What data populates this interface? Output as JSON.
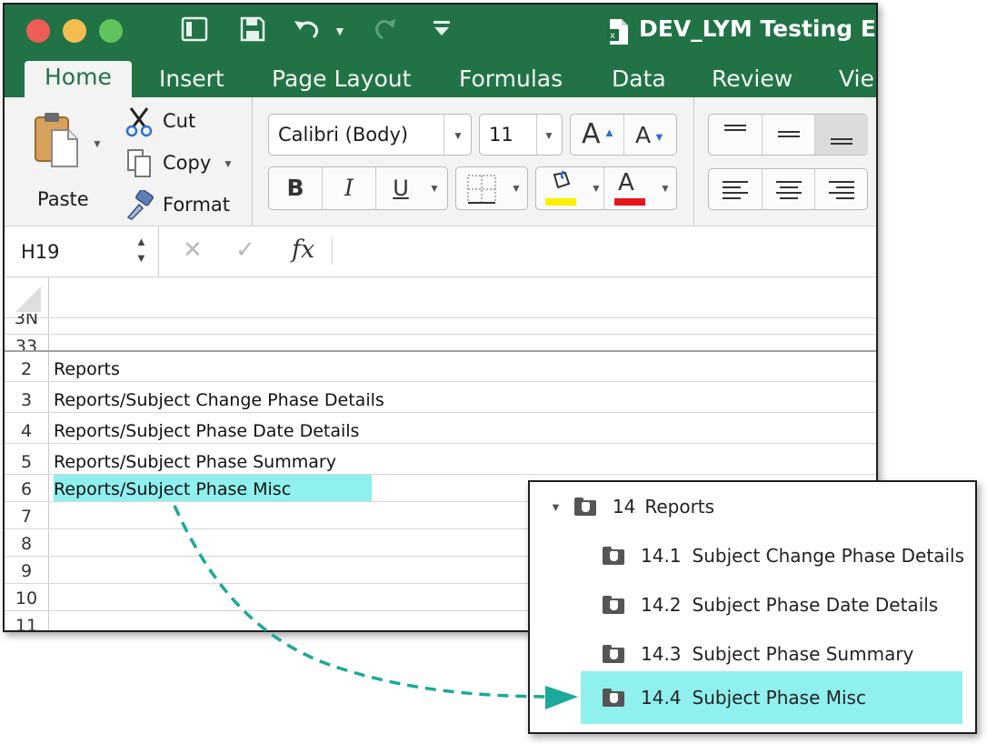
{
  "titlebar": {
    "doc_icon": "excel-file-icon",
    "doc_title": "DEV_LYM Testing Ex",
    "traffic_colors": [
      "#ee5c56",
      "#f5bd4f",
      "#5fc45c"
    ]
  },
  "tabs": [
    {
      "label": "Home",
      "active": true
    },
    {
      "label": "Insert"
    },
    {
      "label": "Page Layout"
    },
    {
      "label": "Formulas"
    },
    {
      "label": "Data"
    },
    {
      "label": "Review"
    },
    {
      "label": "Vie"
    }
  ],
  "clipboard": {
    "paste": "Paste",
    "cut": "Cut",
    "copy": "Copy",
    "format": "Format"
  },
  "font": {
    "family": "Calibri (Body)",
    "size": "11",
    "bold": "B",
    "italic": "I",
    "underline": "U",
    "grow": "A",
    "shrink": "A",
    "font_color_letter": "A",
    "highlight_color": "#ffee00",
    "font_color": "#e8141b"
  },
  "formula_bar": {
    "name_box": "H19",
    "cancel": "✕",
    "enter": "✓",
    "fx": "fx"
  },
  "sheet": {
    "partial_rows": [
      "3N",
      "33"
    ],
    "rows": [
      {
        "num": "2",
        "text": "Reports"
      },
      {
        "num": "3",
        "text": "Reports/Subject Change Phase Details"
      },
      {
        "num": "4",
        "text": "Reports/Subject Phase Date Details"
      },
      {
        "num": "5",
        "text": "Reports/Subject Phase Summary"
      },
      {
        "num": "6",
        "text": "Reports/Subject Phase Misc",
        "highlight": true
      },
      {
        "num": "7",
        "text": ""
      },
      {
        "num": "8",
        "text": ""
      },
      {
        "num": "9",
        "text": ""
      },
      {
        "num": "10",
        "text": ""
      },
      {
        "num": "11",
        "text": ""
      }
    ],
    "highlight_color": "#8ff0ee"
  },
  "tree": {
    "root": {
      "num": "14",
      "label": "Reports"
    },
    "children": [
      {
        "num": "14.1",
        "label": "Subject Change Phase Details"
      },
      {
        "num": "14.2",
        "label": "Subject Phase Date Details"
      },
      {
        "num": "14.3",
        "label": "Subject Phase Summary"
      },
      {
        "num": "14.4",
        "label": "Subject Phase Misc",
        "selected": true
      }
    ],
    "selected_color": "#8ff0ee",
    "arrow_color": "#1aa99a"
  }
}
